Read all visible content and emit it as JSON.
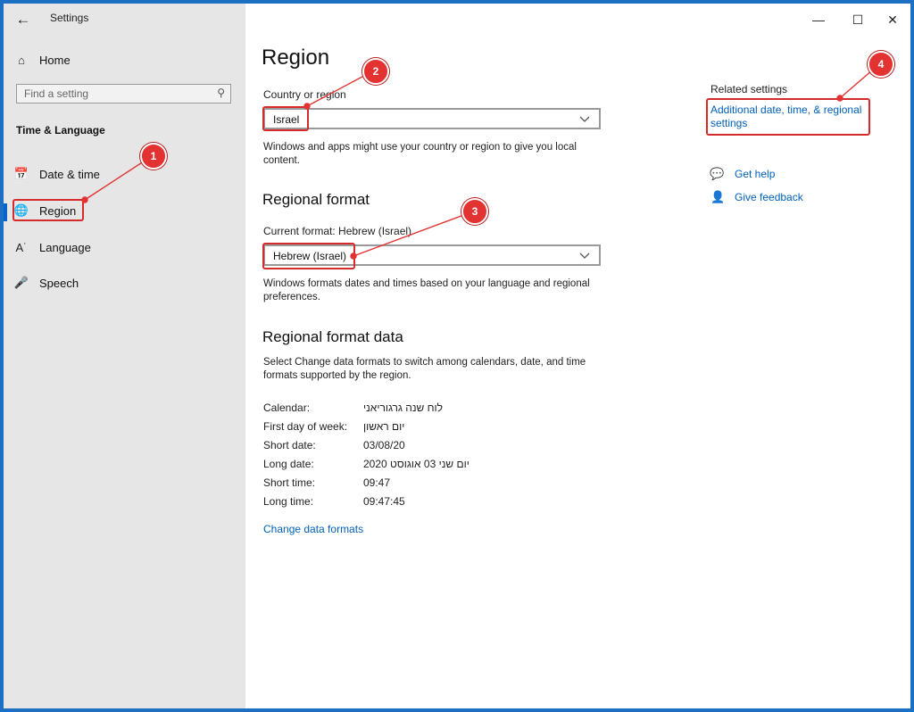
{
  "window": {
    "title": "Settings",
    "controls": [
      "minimize",
      "maximize",
      "close"
    ]
  },
  "sidebar": {
    "home_label": "Home",
    "search_placeholder": "Find a setting",
    "section_title": "Time & Language",
    "items": [
      {
        "label": "Date & time",
        "icon": "calendar-clock-icon"
      },
      {
        "label": "Region",
        "icon": "globe-icon",
        "selected": true
      },
      {
        "label": "Language",
        "icon": "language-icon"
      },
      {
        "label": "Speech",
        "icon": "microphone-icon"
      }
    ]
  },
  "main": {
    "title": "Region",
    "country_label": "Country or region",
    "country_value": "Israel",
    "country_desc": "Windows and apps might use your country or region to give you local content.",
    "format_heading": "Regional format",
    "current_format": "Current format: Hebrew (Israel)",
    "format_value": "Hebrew (Israel)",
    "format_desc": "Windows formats dates and times based on your language and regional preferences.",
    "data_heading": "Regional format data",
    "data_desc": "Select Change data formats to switch among calendars, date, and time formats supported by the region.",
    "data_rows": [
      {
        "key": "Calendar:",
        "value": "לוח שנה גרגוריאני"
      },
      {
        "key": "First day of week:",
        "value": "יום ראשון"
      },
      {
        "key": "Short date:",
        "value": "03/08/20"
      },
      {
        "key": "Long date:",
        "value": "יום שני 03 אוגוסט 2020"
      },
      {
        "key": "Short time:",
        "value": "09:47"
      },
      {
        "key": "Long time:",
        "value": "09:47:45"
      }
    ],
    "change_link": "Change data formats"
  },
  "related": {
    "heading": "Related settings",
    "link": "Additional date, time, & regional settings",
    "help": "Get help",
    "feedback": "Give feedback"
  },
  "annotations": {
    "badge1": "1",
    "badge2": "2",
    "badge3": "3",
    "badge4": "4",
    "color": "#e23232"
  }
}
